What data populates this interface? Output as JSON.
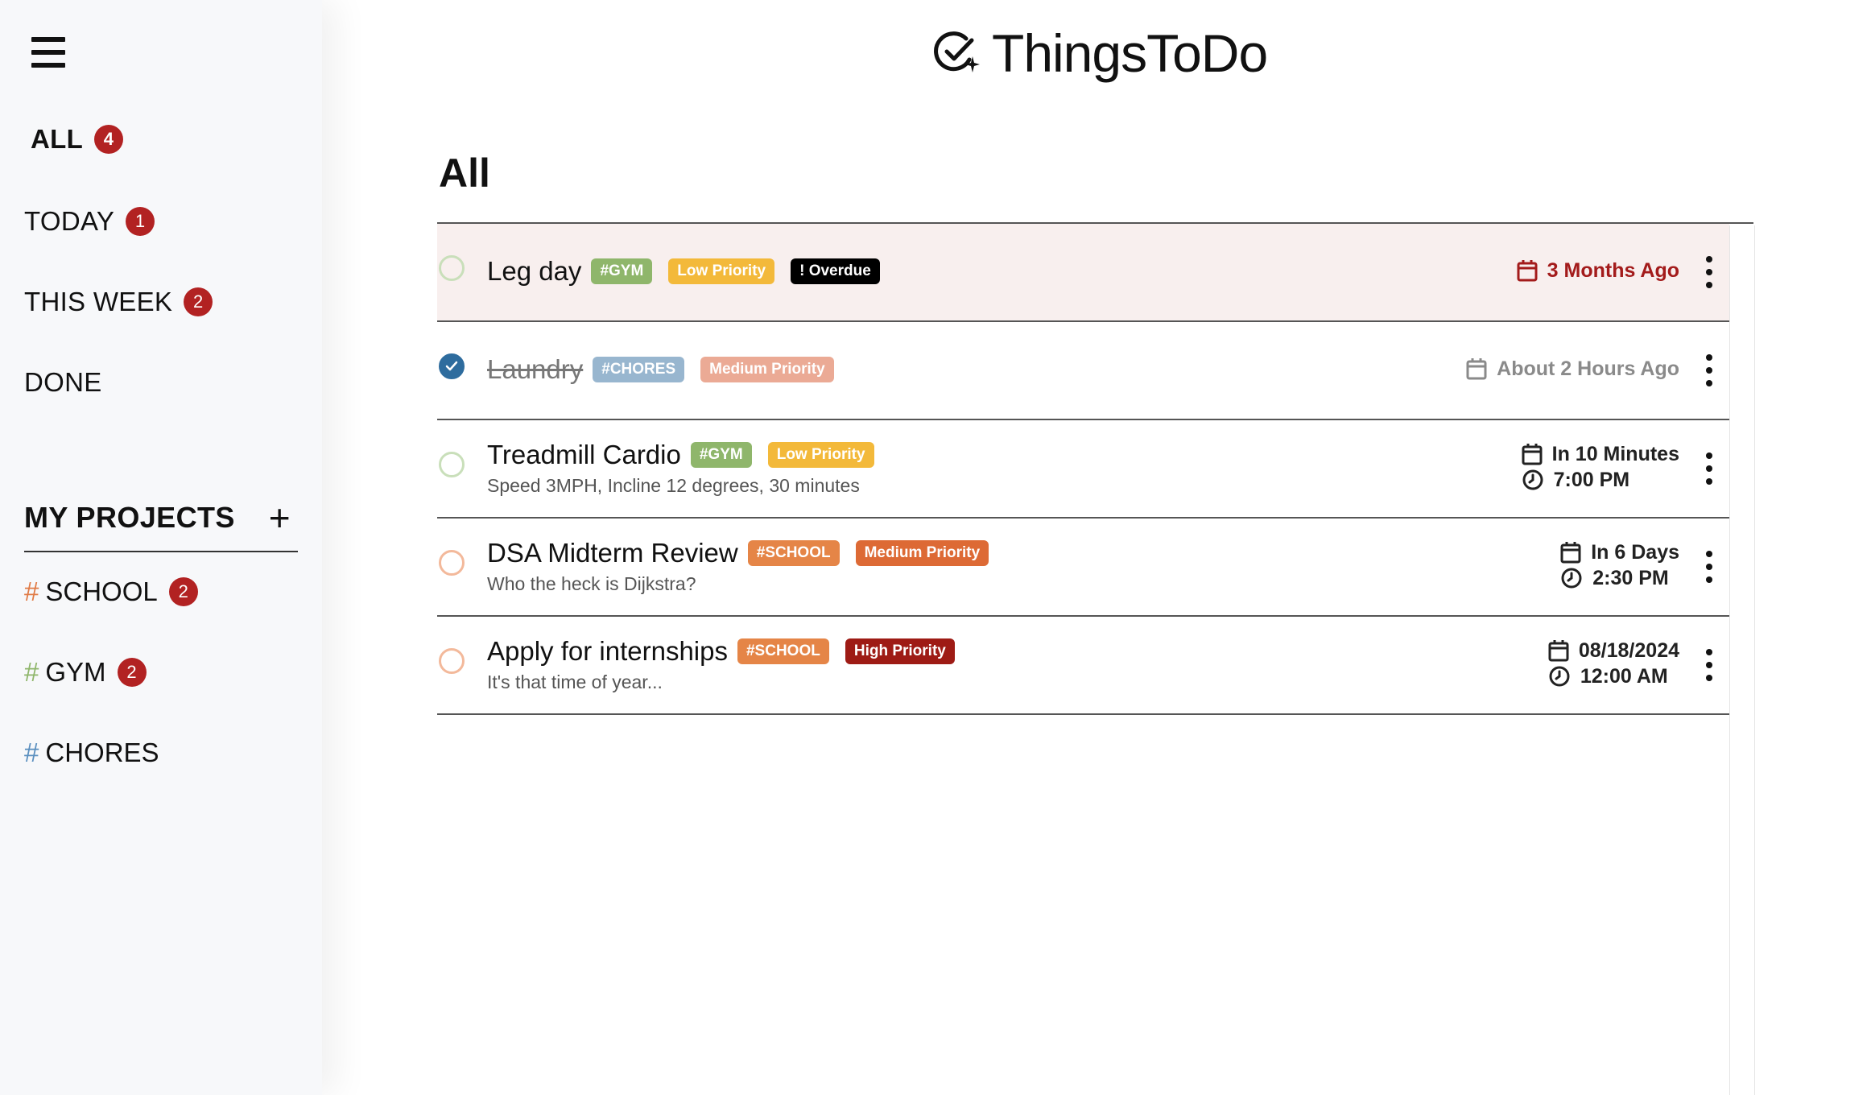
{
  "app": {
    "name": "ThingsToDo"
  },
  "sidebar": {
    "nav": [
      {
        "label": "ALL",
        "count": "4"
      },
      {
        "label": "TODAY",
        "count": "1"
      },
      {
        "label": "THIS WEEK",
        "count": "2"
      },
      {
        "label": "DONE"
      }
    ],
    "projects_header": "MY PROJECTS",
    "add_icon": "+",
    "projects": [
      {
        "hash": "#",
        "name": "SCHOOL",
        "count": "2",
        "color": "#e07a45"
      },
      {
        "hash": "#",
        "name": "GYM",
        "count": "2",
        "color": "#8fb66b"
      },
      {
        "hash": "#",
        "name": "CHORES",
        "color": "#5a8fbf"
      }
    ]
  },
  "main": {
    "title": "All",
    "tasks": [
      {
        "title": "Leg day",
        "tag": "#GYM",
        "priority": "Low Priority",
        "overdue": "! Overdue",
        "date": "3 Months Ago"
      },
      {
        "title": "Laundry",
        "tag": "#CHORES",
        "priority": "Medium Priority",
        "date": "About 2 Hours Ago",
        "completed": true
      },
      {
        "title": "Treadmill Cardio",
        "tag": "#GYM",
        "priority": "Low Priority",
        "description": "Speed 3MPH, Incline 12 degrees, 30 minutes",
        "date": "In 10 Minutes",
        "time": "7:00 PM"
      },
      {
        "title": "DSA Midterm Review",
        "tag": "#SCHOOL",
        "priority": "Medium Priority",
        "description": "Who the heck is Dijkstra?",
        "date": "In 6 Days",
        "time": "2:30 PM"
      },
      {
        "title": "Apply for internships",
        "tag": "#SCHOOL",
        "priority": "High Priority",
        "description": "It's that time of year...",
        "date": "08/18/2024",
        "time": "12:00 AM"
      }
    ]
  },
  "colors": {
    "badge": "#b22222",
    "gym_tag": "#8fb66b",
    "school_tag": "#e58547",
    "chores_tag": "#98b6cf",
    "low_priority": "#f3b93a",
    "medium_priority": "#dd6a35",
    "medium_priority_done": "#ebaa95",
    "high_priority": "#9e1b15",
    "overdue_tag": "#000000",
    "overdue_date": "#a31b1b"
  },
  "icons": [
    "menu-icon",
    "check-sparkle-logo-icon",
    "plus-icon",
    "calendar-icon",
    "clock-icon",
    "more-vertical-icon",
    "checkmark-icon"
  ]
}
